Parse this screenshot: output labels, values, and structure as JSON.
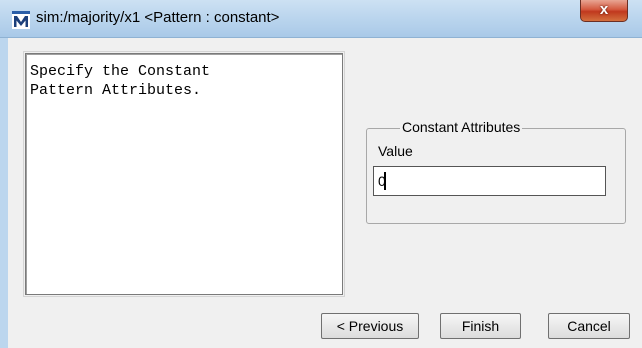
{
  "window": {
    "title": "sim:/majority/x1 <Pattern : constant>",
    "app_icon": "modelsim-m-icon",
    "close_label": "x"
  },
  "description": {
    "text": "Specify the Constant\nPattern Attributes."
  },
  "constant_attributes": {
    "legend": "Constant Attributes",
    "value_label": "Value",
    "value": "0"
  },
  "buttons": {
    "previous_label": "< Previous",
    "finish_label": "Finish",
    "cancel_label": "Cancel"
  },
  "colors": {
    "titlebar": "#bcd6ee",
    "close": "#c0381e",
    "dialog_bg": "#f0f0f0"
  }
}
